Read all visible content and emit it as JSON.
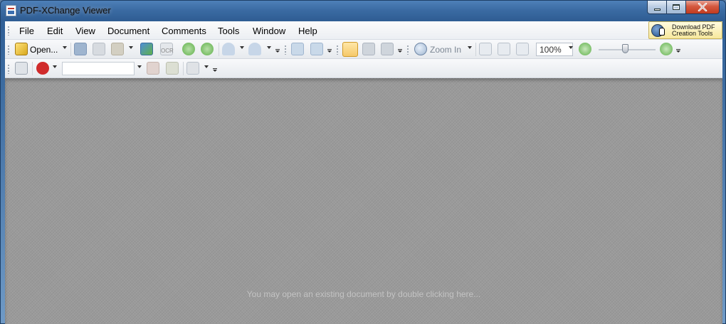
{
  "window": {
    "title": "PDF-XChange Viewer",
    "controls": {
      "minimize_icon": "minimize-icon",
      "maximize_icon": "maximize-icon",
      "close_icon": "close-icon"
    }
  },
  "menubar": {
    "items": [
      "File",
      "Edit",
      "View",
      "Document",
      "Comments",
      "Tools",
      "Window",
      "Help"
    ],
    "promo": {
      "line1": "Download PDF",
      "line2": "Creation Tools"
    }
  },
  "toolbar": {
    "open_label": "Open...",
    "zoom_in_label": "Zoom In",
    "zoom_value": "100%",
    "ocr_label": "OCR",
    "icons": [
      "open-folder-icon",
      "save-icon",
      "print-icon",
      "email-icon",
      "scan-icon",
      "ocr-icon",
      "back-icon",
      "forward-icon",
      "undo-icon",
      "redo-icon",
      "rotate-left-icon",
      "rotate-right-icon",
      "hand-tool-icon",
      "snapshot-icon",
      "select-text-icon",
      "zoom-in-icon",
      "actual-size-icon",
      "fit-page-icon",
      "fit-width-icon",
      "zoom-out-icon",
      "zoom-plus-icon"
    ]
  },
  "toolbar2": {
    "search_value": "",
    "icons": [
      "find-icon",
      "ask-icon",
      "highlight-prev-icon",
      "highlight-next-icon",
      "stamp-icon"
    ]
  },
  "document": {
    "hint": "You may open an existing document by double clicking here..."
  },
  "colors": {
    "hand_tool_active": "#f5c96a",
    "nav_green": "#5fb04a",
    "doc_background": "#9a9a9a"
  }
}
